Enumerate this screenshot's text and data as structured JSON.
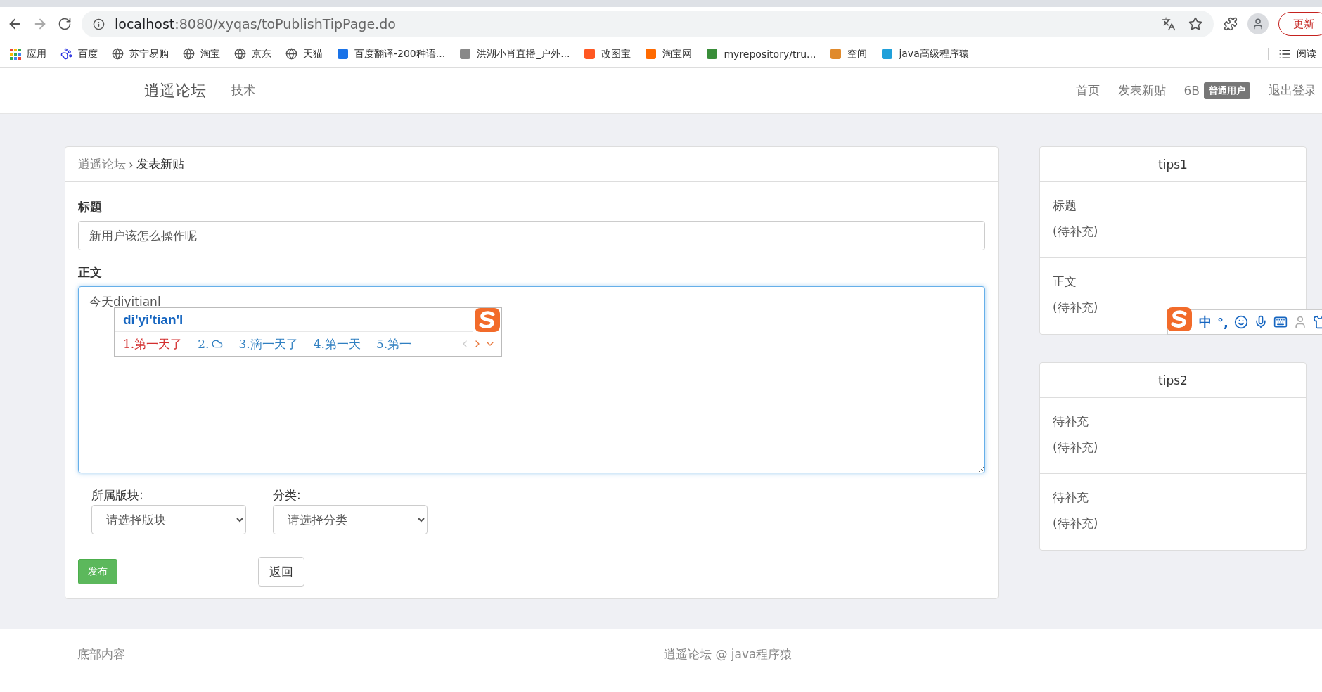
{
  "browser": {
    "url_host": "localhost",
    "url_rest": ":8080/xyqas/toPublishTipPage.do",
    "update_button": "更新",
    "bookmarks": [
      {
        "label": "应用"
      },
      {
        "label": "百度"
      },
      {
        "label": "苏宁易购"
      },
      {
        "label": "淘宝"
      },
      {
        "label": "京东"
      },
      {
        "label": "天猫"
      },
      {
        "label": "百度翻译-200种语..."
      },
      {
        "label": "洪湖小肖直播_户外..."
      },
      {
        "label": "改图宝"
      },
      {
        "label": "淘宝网"
      },
      {
        "label": "myrepository/tru..."
      },
      {
        "label": "空间"
      },
      {
        "label": "java高级程序猿"
      }
    ],
    "reading_list": "阅读"
  },
  "navbar": {
    "brand": "逍遥论坛",
    "links": [
      "技术"
    ],
    "right_links": [
      "首页",
      "发表新贴"
    ],
    "user": "6B",
    "badge": "普通用户",
    "logout": "退出登录"
  },
  "breadcrumb": {
    "separator": "›",
    "items": [
      "逍遥论坛",
      "发表新贴"
    ]
  },
  "form": {
    "title_label": "标题",
    "title_value": "新用户该怎么操作呢",
    "body_label": "正文",
    "body_value": "今天diyitianl",
    "ime": {
      "composition": "di'yi'tian'l",
      "candidates": [
        {
          "kind": "text",
          "number": "1.",
          "text": "第一天了",
          "selected": true
        },
        {
          "kind": "cloud",
          "number": "2.",
          "selected": false
        },
        {
          "kind": "text",
          "number": "3.",
          "text": "滴一天了",
          "selected": false
        },
        {
          "kind": "text",
          "number": "4.",
          "text": "第一天",
          "selected": false
        },
        {
          "kind": "text",
          "number": "5.",
          "text": "第一",
          "selected": false
        }
      ]
    },
    "selects": [
      {
        "label": "所属版块:",
        "placeholder": "请选择版块"
      },
      {
        "label": "分类:",
        "placeholder": "请选择分类"
      }
    ],
    "submit": "发布",
    "back": "返回"
  },
  "tips": [
    {
      "title": "tips1",
      "items": [
        {
          "label": "标题",
          "value": "(待补充)"
        },
        {
          "label": "正文",
          "value": "(待补充)"
        }
      ]
    },
    {
      "title": "tips2",
      "items": [
        {
          "label": "待补充",
          "value": "(待补充)"
        },
        {
          "label": "待补充",
          "value": "(待补充)"
        }
      ]
    }
  ],
  "ime_toolbar": {
    "mode": "中",
    "punctuation": "°,"
  },
  "footer": {
    "left": "底部内容",
    "right": "逍遥论坛 @ java程序猿"
  }
}
